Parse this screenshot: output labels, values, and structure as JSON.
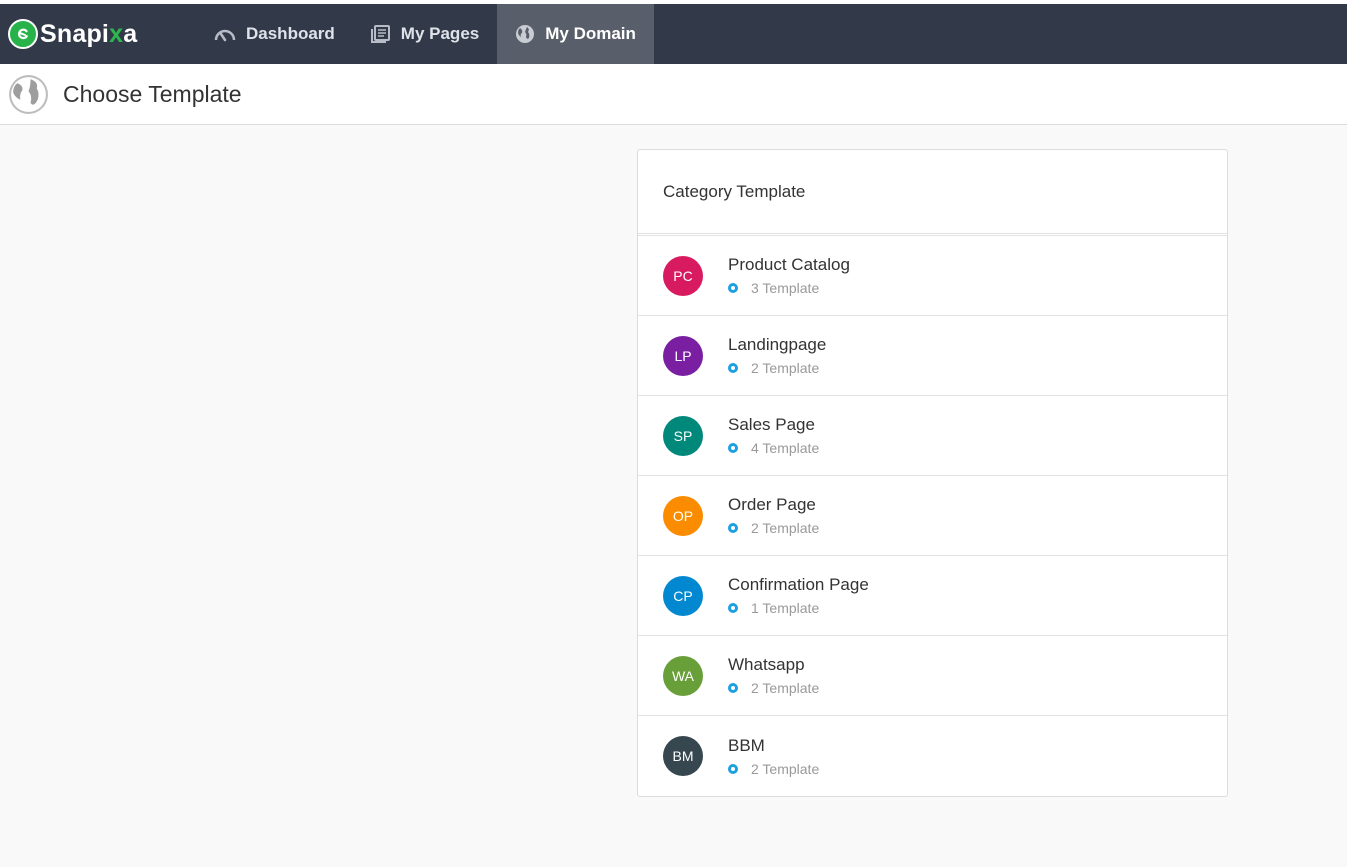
{
  "brand": {
    "name_prefix": "Snapi",
    "name_x": "x",
    "name_suffix": "a"
  },
  "nav": [
    {
      "label": "Dashboard",
      "icon": "speedometer-icon",
      "active": false
    },
    {
      "label": "My Pages",
      "icon": "pages-icon",
      "active": false
    },
    {
      "label": "My Domain",
      "icon": "globe-icon",
      "active": true
    }
  ],
  "header": {
    "title": "Choose Template",
    "icon": "globe-icon"
  },
  "panel": {
    "title": "Category Template",
    "items": [
      {
        "initials": "PC",
        "name": "Product Catalog",
        "count": "3 Template",
        "color": "#d81b60"
      },
      {
        "initials": "LP",
        "name": "Landingpage",
        "count": "2 Template",
        "color": "#7b1fa2"
      },
      {
        "initials": "SP",
        "name": "Sales Page",
        "count": "4 Template",
        "color": "#00897b"
      },
      {
        "initials": "OP",
        "name": "Order Page",
        "count": "2 Template",
        "color": "#fb8c00"
      },
      {
        "initials": "CP",
        "name": "Confirmation Page",
        "count": "1 Template",
        "color": "#0288d1"
      },
      {
        "initials": "WA",
        "name": "Whatsapp",
        "count": "2 Template",
        "color": "#689f38"
      },
      {
        "initials": "BM",
        "name": "BBM",
        "count": "2 Template",
        "color": "#37474f"
      }
    ]
  }
}
